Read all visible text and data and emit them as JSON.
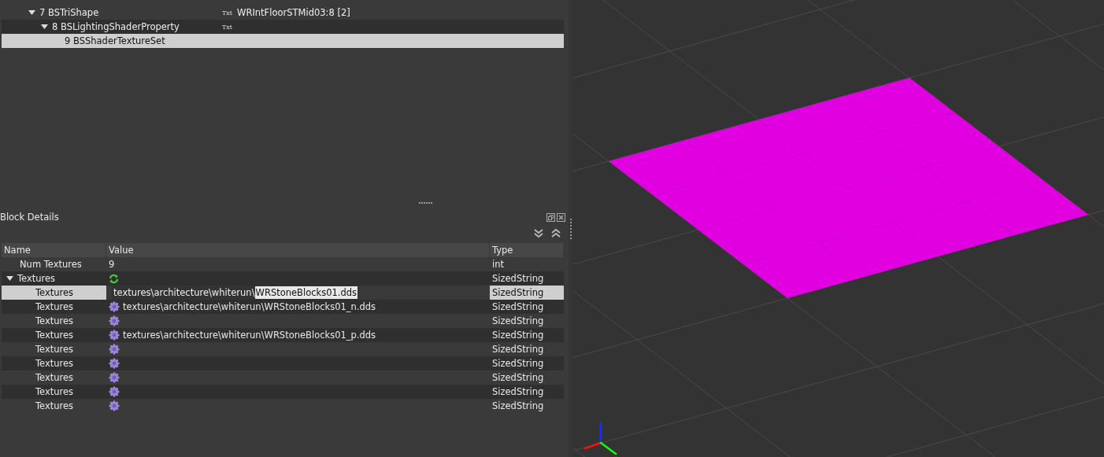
{
  "tree": [
    {
      "label": "7 BSTriShape",
      "badge": "Txt",
      "value": "WRIntFloorSTMid03:8 [2]",
      "expanded": true,
      "selected": false,
      "children": [
        {
          "label": "8 BSLightingShaderProperty",
          "badge": "Txt",
          "expanded": true,
          "selected": false,
          "children": [
            {
              "label": "9 BSShaderTextureSet",
              "selected": true
            }
          ]
        }
      ]
    }
  ],
  "block_details": {
    "title": "Block Details",
    "columns": [
      "Name",
      "Value",
      "Type"
    ],
    "rows": [
      {
        "name": "Num Textures",
        "value": "9",
        "type": "int",
        "kind": "plain",
        "selected": false
      },
      {
        "name": "Textures",
        "kind": "group",
        "type": "SizedString",
        "expanded": true,
        "selected": false,
        "children": [
          {
            "name": "Textures",
            "type": "SizedString",
            "selected": true,
            "editing": {
              "text": "textures\\architecture\\whiterun\\",
              "selected_text": "WRStoneBlocks01.dds"
            }
          },
          {
            "name": "Textures",
            "kind": "texture",
            "value": "textures\\architecture\\whiterun\\WRStoneBlocks01_n.dds",
            "type": "SizedString",
            "selected": false
          },
          {
            "name": "Textures",
            "kind": "texture",
            "type": "SizedString",
            "selected": false
          },
          {
            "name": "Textures",
            "kind": "texture",
            "value": "textures\\architecture\\whiterun\\WRStoneBlocks01_p.dds",
            "type": "SizedString",
            "selected": false
          },
          {
            "name": "Textures",
            "kind": "texture",
            "type": "SizedString",
            "selected": false
          },
          {
            "name": "Textures",
            "kind": "texture",
            "type": "SizedString",
            "selected": false
          },
          {
            "name": "Textures",
            "kind": "texture",
            "type": "SizedString",
            "selected": false
          },
          {
            "name": "Textures",
            "kind": "texture",
            "type": "SizedString",
            "selected": false
          },
          {
            "name": "Textures",
            "kind": "texture",
            "type": "SizedString",
            "selected": false
          }
        ]
      }
    ]
  }
}
